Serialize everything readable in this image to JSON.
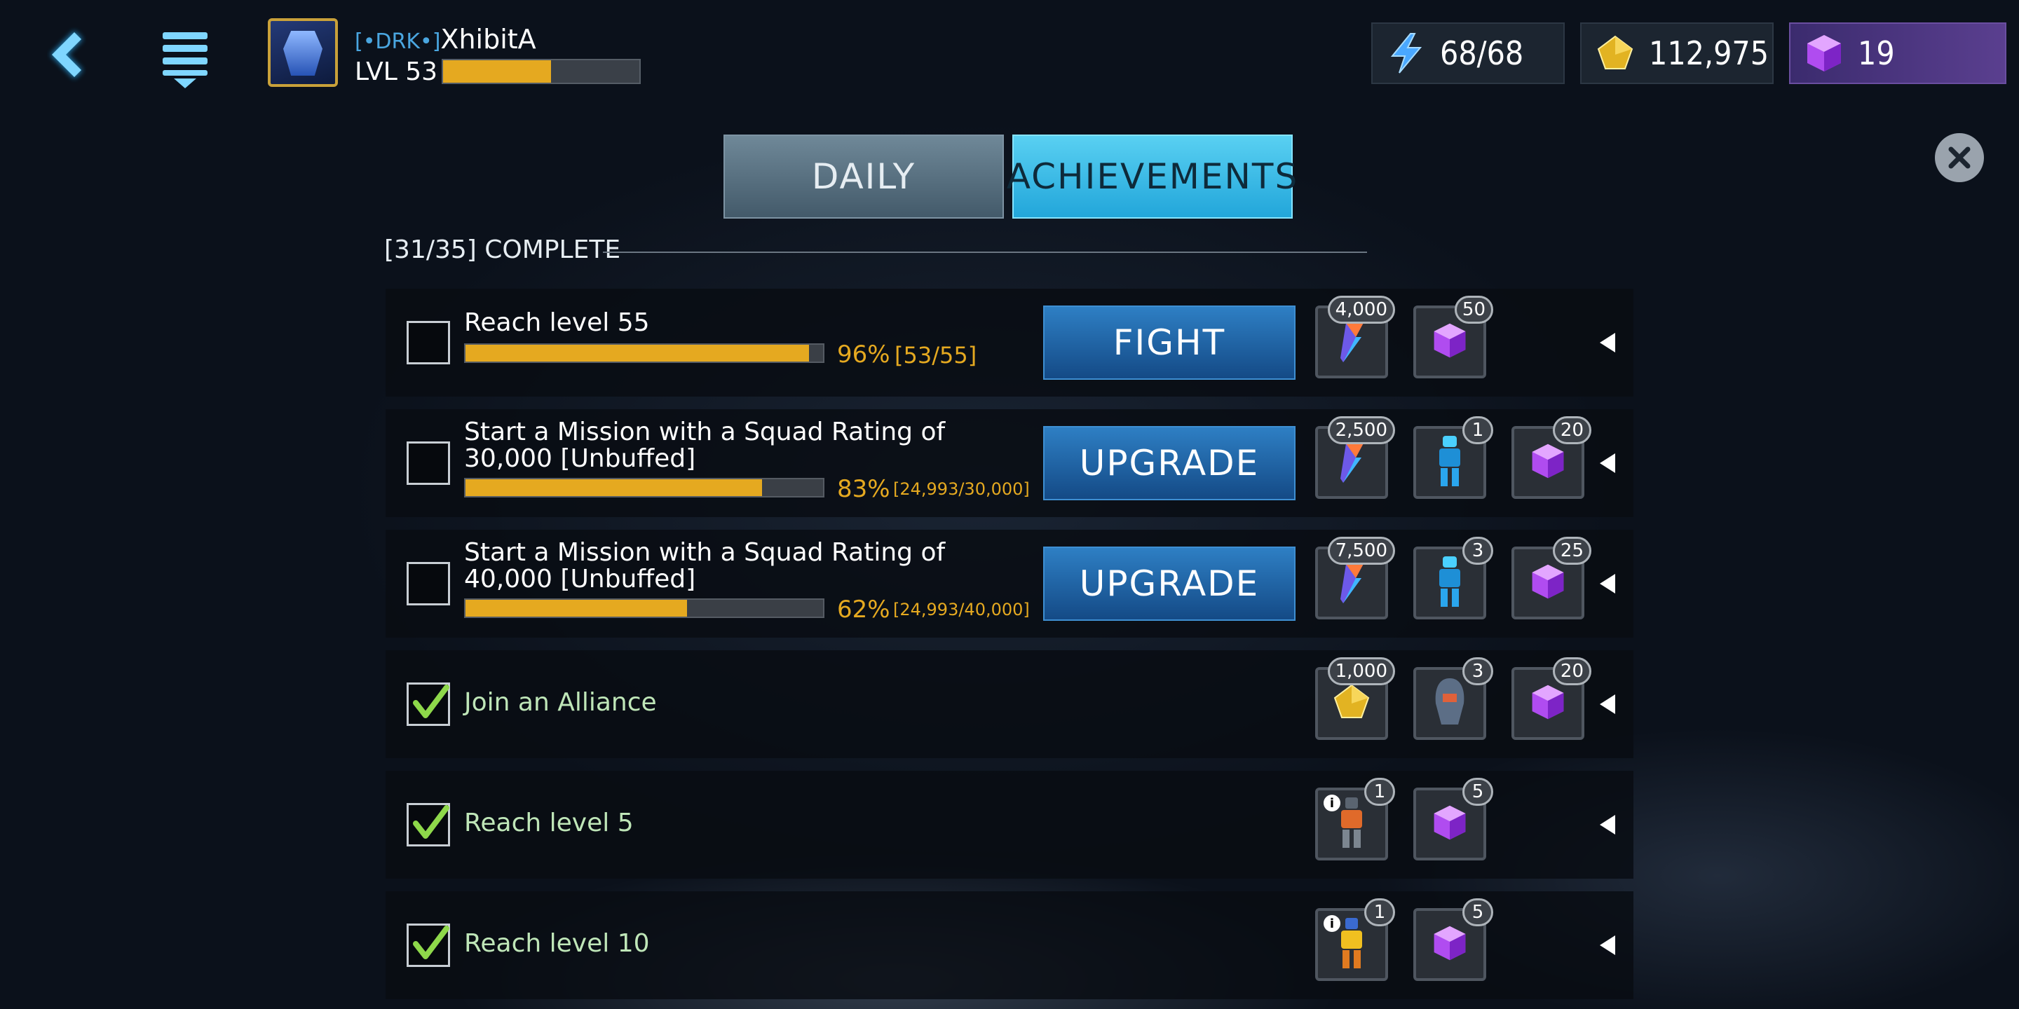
{
  "player": {
    "tag": "[•DRK•]",
    "name": "XhibitA",
    "level_text": "LVL 53",
    "xp_fraction": 0.55
  },
  "resources": {
    "energy": "68/68",
    "gold": "112,975",
    "gems": "19"
  },
  "tabs": [
    {
      "label": "DAILY",
      "active": false
    },
    {
      "label": "ACHIEVEMENTS",
      "active": true
    }
  ],
  "summary": "[31/35] COMPLETE",
  "achievements": [
    {
      "title": "Reach level 55",
      "progress": 0.96,
      "pct": "96%",
      "frac": "[53/55]",
      "button": "FIGHT",
      "rewards": [
        {
          "icon": "shard-icon",
          "count": "4,000"
        },
        {
          "icon": "gem-cube-icon",
          "count": "50"
        }
      ]
    },
    {
      "title": "Start a Mission with a Squad Rating of 30,000 [Unbuffed]",
      "progress": 0.83,
      "pct": "83%",
      "frac": "[24,993/30,000]",
      "button": "UPGRADE",
      "rewards": [
        {
          "icon": "shard-icon",
          "count": "2,500"
        },
        {
          "icon": "blue-bot-icon",
          "count": "1"
        },
        {
          "icon": "gem-cube-icon",
          "count": "20"
        }
      ]
    },
    {
      "title": "Start a Mission with a Squad Rating of 40,000 [Unbuffed]",
      "progress": 0.62,
      "pct": "62%",
      "frac": "[24,993/40,000]",
      "button": "UPGRADE",
      "rewards": [
        {
          "icon": "shard-icon",
          "count": "7,500"
        },
        {
          "icon": "blue-bot-icon",
          "count": "3"
        },
        {
          "icon": "gem-cube-icon",
          "count": "25"
        }
      ]
    },
    {
      "title": "Join an Alliance",
      "done": true,
      "rewards": [
        {
          "icon": "gold-icon",
          "count": "1,000"
        },
        {
          "icon": "helmet-icon",
          "count": "3"
        },
        {
          "icon": "gem-cube-icon",
          "count": "20"
        }
      ]
    },
    {
      "title": "Reach level 5",
      "done": true,
      "rewards": [
        {
          "icon": "robot-orange-icon",
          "count": "1"
        },
        {
          "icon": "gem-cube-icon",
          "count": "5"
        }
      ]
    },
    {
      "title": "Reach level 10",
      "done": true,
      "rewards": [
        {
          "icon": "robot-yellow-icon",
          "count": "1"
        },
        {
          "icon": "gem-cube-icon",
          "count": "5"
        }
      ]
    }
  ],
  "colors": {
    "progress": "#e5a920",
    "tab_active": "#22a6da",
    "button": "#144a86"
  }
}
